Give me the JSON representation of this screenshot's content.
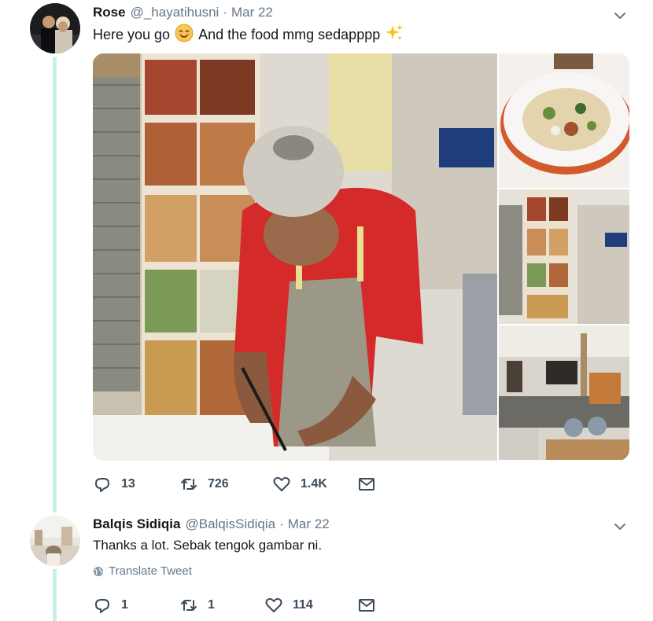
{
  "tweet1": {
    "display_name": "Rose",
    "handle": "@_hayatihusni",
    "separator": "·",
    "date": "Mar 22",
    "text_before_emoji": "Here you go",
    "text_after_emoji": "And the food mmg sedapppp",
    "emoji_1": "smiling-face-emoji",
    "emoji_2": "sparkles-emoji",
    "replies": "13",
    "retweets": "726",
    "likes": "1.4K"
  },
  "tweet2": {
    "display_name": "Balqis Sidiqia",
    "handle": "@BalqisSidiqia",
    "separator": "·",
    "date": "Mar 22",
    "text": "Thanks a lot. Sebak tengok gambar ni.",
    "translate_label": "Translate Tweet",
    "replies": "1",
    "retweets": "1",
    "likes": "114"
  },
  "colors": {
    "thread_line": "#c6f1e5",
    "secondary_text": "#657786",
    "primary_text": "#14171a"
  },
  "icons": {
    "reply": "reply-icon",
    "retweet": "retweet-icon",
    "like": "heart-icon",
    "dm": "envelope-icon",
    "menu": "chevron-down-icon",
    "translate": "globe-icon"
  }
}
